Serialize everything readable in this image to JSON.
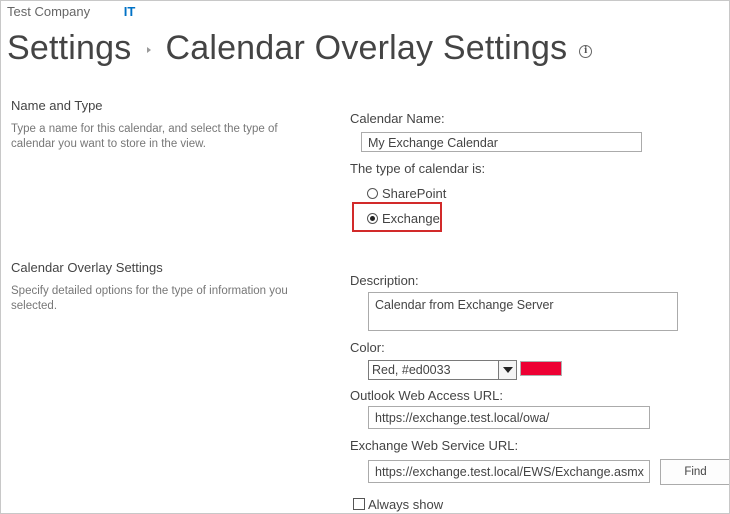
{
  "topbar": {
    "company": "Test Company",
    "site": "IT"
  },
  "title": {
    "parent": "Settings",
    "current": "Calendar Overlay Settings",
    "info_icon": "info-icon"
  },
  "sections": {
    "name_type": {
      "title": "Name and Type",
      "description": "Type a name for this calendar, and select the type of calendar you want to store in the view."
    },
    "overlay": {
      "title": "Calendar Overlay Settings",
      "description": "Specify detailed options for the type of information you selected."
    }
  },
  "form": {
    "calendar_name_label": "Calendar Name:",
    "calendar_name_value": "My Exchange Calendar",
    "type_label": "The type of calendar is:",
    "type_options": [
      "SharePoint",
      "Exchange"
    ],
    "type_selected": "Exchange",
    "description_label": "Description:",
    "description_value": "Calendar from Exchange Server",
    "color_label": "Color:",
    "color_value": "Red, #ed0033",
    "color_swatch": "#ed0033",
    "owa_label": "Outlook Web Access URL:",
    "owa_value": "https://exchange.test.local/owa/",
    "ews_label": "Exchange Web Service URL:",
    "ews_value": "https://exchange.test.local/EWS/Exchange.asmx",
    "find_label": "Find",
    "always_show_label": "Always show",
    "always_show_checked": false
  },
  "colors": {
    "highlight": "#d22a2a",
    "link": "#0072c6"
  }
}
